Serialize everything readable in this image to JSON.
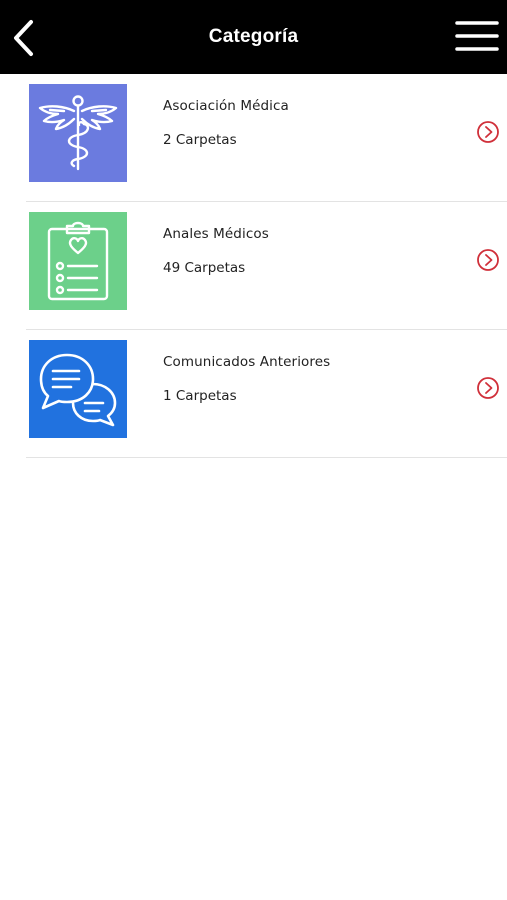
{
  "header": {
    "title": "Categoría",
    "back_icon": "chevron-left-icon",
    "menu_icon": "hamburger-menu-icon"
  },
  "colors": {
    "header_bg": "#000000",
    "arrow": "#d0303a",
    "divider": "#e3e3e3"
  },
  "categories": [
    {
      "name": "Asociación Médica",
      "count": "2 Carpetas",
      "icon": "caduceus-icon",
      "color": "#6b7bdf"
    },
    {
      "name": "Anales Médicos",
      "count": "49 Carpetas",
      "icon": "medical-clipboard-icon",
      "color": "#6cd08a"
    },
    {
      "name": "Comunicados Anteriores",
      "count": "1 Carpetas",
      "icon": "chat-bubbles-icon",
      "color": "#2172df"
    }
  ]
}
